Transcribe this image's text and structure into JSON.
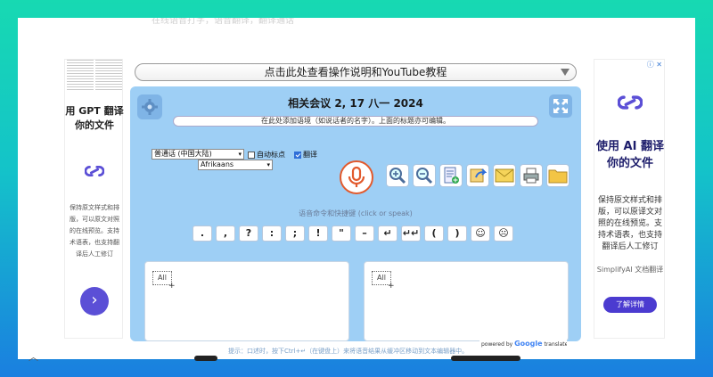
{
  "page": {
    "faded_top_text": "在线语音打字，语音翻译，翻译通话"
  },
  "ad_left": {
    "headline": "用 GPT 翻译你的文件",
    "body": "保持原文样式和排版，可以原文对照的在线预览。支持术语表，也支持翻译后人工修订",
    "next_label": "›"
  },
  "ad_right": {
    "adchoice": "ⓘ ✕",
    "headline": "使用 AI 翻译你的文件",
    "body": "保持原文样式和排版，可以原译文对照的在线预览。支持术语表，也支持翻译后人工修订",
    "small": "SimplifyAI 文档翻译",
    "cta": "了解详情"
  },
  "instructions": {
    "label": "点击此处查看操作说明和YouTube教程"
  },
  "panel": {
    "title": "相关会议 2, 17 八一 2024",
    "subtitle": "在此处添加语境（如说话者的名字）。上面的标题亦可编辑。",
    "source_language": "普通话 (中国大陆)",
    "target_language": "Afrikaans",
    "auto_punct_label": "自动标点",
    "translate_label": "翻译",
    "translate_checked": true,
    "auto_punct_checked": false,
    "voice_commands_label": "语音命令和快捷键 (click or speak)",
    "punctuation": [
      ".",
      ",",
      "?",
      ":",
      ";",
      "!",
      "\"",
      "–",
      "↵",
      "↵↵",
      "(",
      ")",
      "☺",
      "☹"
    ],
    "editor_left_all": "All",
    "editor_right_all": "All",
    "powered_by": "powered by",
    "powered_brand": "Google",
    "powered_suffix": "translate",
    "tip": "提示：口述时，按下Ctrl+↵（在键盘上）来将语音结果从缓冲区移动到文本编辑器中。"
  },
  "colors": {
    "panel_bg": "#9ecff5",
    "mic_accent": "#e25a2d",
    "cta_bg": "#4b3bd0"
  }
}
